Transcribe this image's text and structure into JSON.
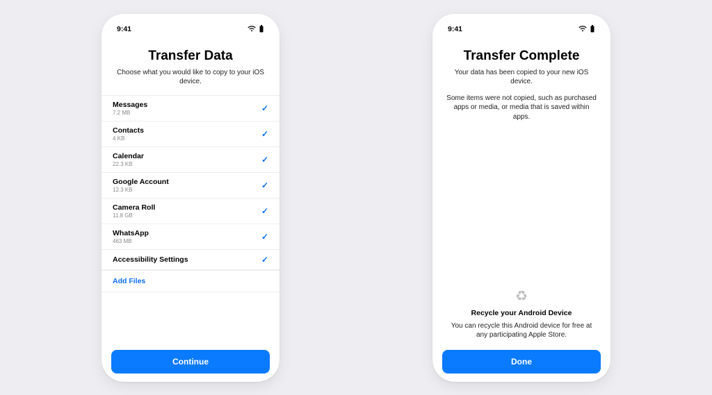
{
  "statusBar": {
    "time": "9:41"
  },
  "leftPhone": {
    "title": "Transfer Data",
    "subtitle": "Choose what you would like to copy to your iOS device.",
    "items": [
      {
        "name": "Messages",
        "size": "7.2 MB"
      },
      {
        "name": "Contacts",
        "size": "4 KB"
      },
      {
        "name": "Calendar",
        "size": "22.3 KB"
      },
      {
        "name": "Google Account",
        "size": "12.3 KB"
      },
      {
        "name": "Camera Roll",
        "size": "11.8 GB"
      },
      {
        "name": "WhatsApp",
        "size": "463 MB"
      },
      {
        "name": "Accessibility Settings",
        "size": ""
      }
    ],
    "addFiles": "Add Files",
    "button": "Continue"
  },
  "rightPhone": {
    "title": "Transfer Complete",
    "subtitle": "Your data has been copied to your new iOS device.",
    "note": "Some items were not copied, such as purchased apps or media, or media that is saved within apps.",
    "recycleTitle": "Recycle your Android Device",
    "recycleText": "You can recycle this Android device for free at any participating Apple Store.",
    "button": "Done"
  }
}
